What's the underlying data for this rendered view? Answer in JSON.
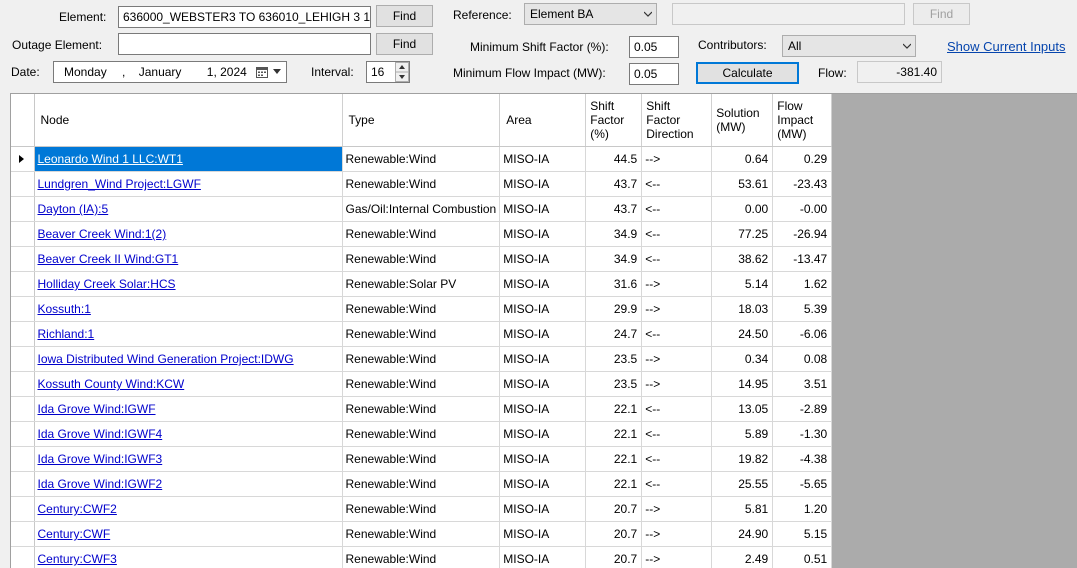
{
  "form": {
    "element_label": "Element:",
    "element_value": "636000_WEBSTER3 TO 636010_LEHIGH 3 1",
    "find_label": "Find",
    "outage_label": "Outage Element:",
    "outage_value": "",
    "outage_find_label": "Find",
    "date_label": "Date:",
    "date_weekday": "Monday",
    "date_sep": ",",
    "date_month": "January",
    "date_day_year": "1, 2024",
    "interval_label": "Interval:",
    "interval_value": "16",
    "reference_label": "Reference:",
    "reference_value": "Element BA",
    "reference_find_label": "Find",
    "min_shift_label": "Minimum Shift Factor (%):",
    "min_shift_value": "0.05",
    "min_flow_label": "Minimum Flow Impact (MW):",
    "min_flow_value": "0.05",
    "contributors_label": "Contributors:",
    "contributors_value": "All",
    "calculate_label": "Calculate",
    "flow_label": "Flow:",
    "flow_value": "-381.40",
    "show_inputs_label": "Show Current Inputs"
  },
  "grid": {
    "columns": [
      "Node",
      "Type",
      "Area",
      "Shift Factor (%)",
      "Shift Factor Direction",
      "Solution (MW)",
      "Flow Impact (MW)"
    ],
    "rows": [
      {
        "node": "Leonardo Wind 1 LLC:WT1",
        "type": "Renewable:Wind",
        "area": "MISO-IA",
        "sf": "44.5",
        "dir": "-->",
        "sol": "0.64",
        "fi": "0.29"
      },
      {
        "node": "Lundgren_Wind Project:LGWF",
        "type": "Renewable:Wind",
        "area": "MISO-IA",
        "sf": "43.7",
        "dir": "<--",
        "sol": "53.61",
        "fi": "-23.43"
      },
      {
        "node": "Dayton (IA):5",
        "type": "Gas/Oil:Internal Combustion",
        "area": "MISO-IA",
        "sf": "43.7",
        "dir": "<--",
        "sol": "0.00",
        "fi": "-0.00"
      },
      {
        "node": "Beaver Creek Wind:1(2)",
        "type": "Renewable:Wind",
        "area": "MISO-IA",
        "sf": "34.9",
        "dir": "<--",
        "sol": "77.25",
        "fi": "-26.94"
      },
      {
        "node": "Beaver Creek II Wind:GT1",
        "type": "Renewable:Wind",
        "area": "MISO-IA",
        "sf": "34.9",
        "dir": "<--",
        "sol": "38.62",
        "fi": "-13.47"
      },
      {
        "node": "Holliday Creek Solar:HCS",
        "type": "Renewable:Solar PV",
        "area": "MISO-IA",
        "sf": "31.6",
        "dir": "-->",
        "sol": "5.14",
        "fi": "1.62"
      },
      {
        "node": "Kossuth:1",
        "type": "Renewable:Wind",
        "area": "MISO-IA",
        "sf": "29.9",
        "dir": "-->",
        "sol": "18.03",
        "fi": "5.39"
      },
      {
        "node": "Richland:1",
        "type": "Renewable:Wind",
        "area": "MISO-IA",
        "sf": "24.7",
        "dir": "<--",
        "sol": "24.50",
        "fi": "-6.06"
      },
      {
        "node": "Iowa Distributed Wind Generation Project:IDWG",
        "type": "Renewable:Wind",
        "area": "MISO-IA",
        "sf": "23.5",
        "dir": "-->",
        "sol": "0.34",
        "fi": "0.08"
      },
      {
        "node": "Kossuth County Wind:KCW",
        "type": "Renewable:Wind",
        "area": "MISO-IA",
        "sf": "23.5",
        "dir": "-->",
        "sol": "14.95",
        "fi": "3.51"
      },
      {
        "node": "Ida Grove Wind:IGWF",
        "type": "Renewable:Wind",
        "area": "MISO-IA",
        "sf": "22.1",
        "dir": "<--",
        "sol": "13.05",
        "fi": "-2.89"
      },
      {
        "node": "Ida Grove Wind:IGWF4",
        "type": "Renewable:Wind",
        "area": "MISO-IA",
        "sf": "22.1",
        "dir": "<--",
        "sol": "5.89",
        "fi": "-1.30"
      },
      {
        "node": "Ida Grove Wind:IGWF3",
        "type": "Renewable:Wind",
        "area": "MISO-IA",
        "sf": "22.1",
        "dir": "<--",
        "sol": "19.82",
        "fi": "-4.38"
      },
      {
        "node": "Ida Grove Wind:IGWF2",
        "type": "Renewable:Wind",
        "area": "MISO-IA",
        "sf": "22.1",
        "dir": "<--",
        "sol": "25.55",
        "fi": "-5.65"
      },
      {
        "node": "Century:CWF2",
        "type": "Renewable:Wind",
        "area": "MISO-IA",
        "sf": "20.7",
        "dir": "-->",
        "sol": "5.81",
        "fi": "1.20"
      },
      {
        "node": "Century:CWF",
        "type": "Renewable:Wind",
        "area": "MISO-IA",
        "sf": "20.7",
        "dir": "-->",
        "sol": "24.90",
        "fi": "5.15"
      },
      {
        "node": "Century:CWF3",
        "type": "Renewable:Wind",
        "area": "MISO-IA",
        "sf": "20.7",
        "dir": "-->",
        "sol": "2.49",
        "fi": "0.51"
      }
    ]
  },
  "icons": {
    "row_indicator": "current-row-arrow-icon",
    "calendar": "calendar-icon",
    "dropdown": "chevron-down-icon",
    "spinner": "spinner-arrows-icon"
  },
  "colors": {
    "selection": "#0078d7",
    "link": "#0000cc",
    "grid_background": "#ababab"
  }
}
